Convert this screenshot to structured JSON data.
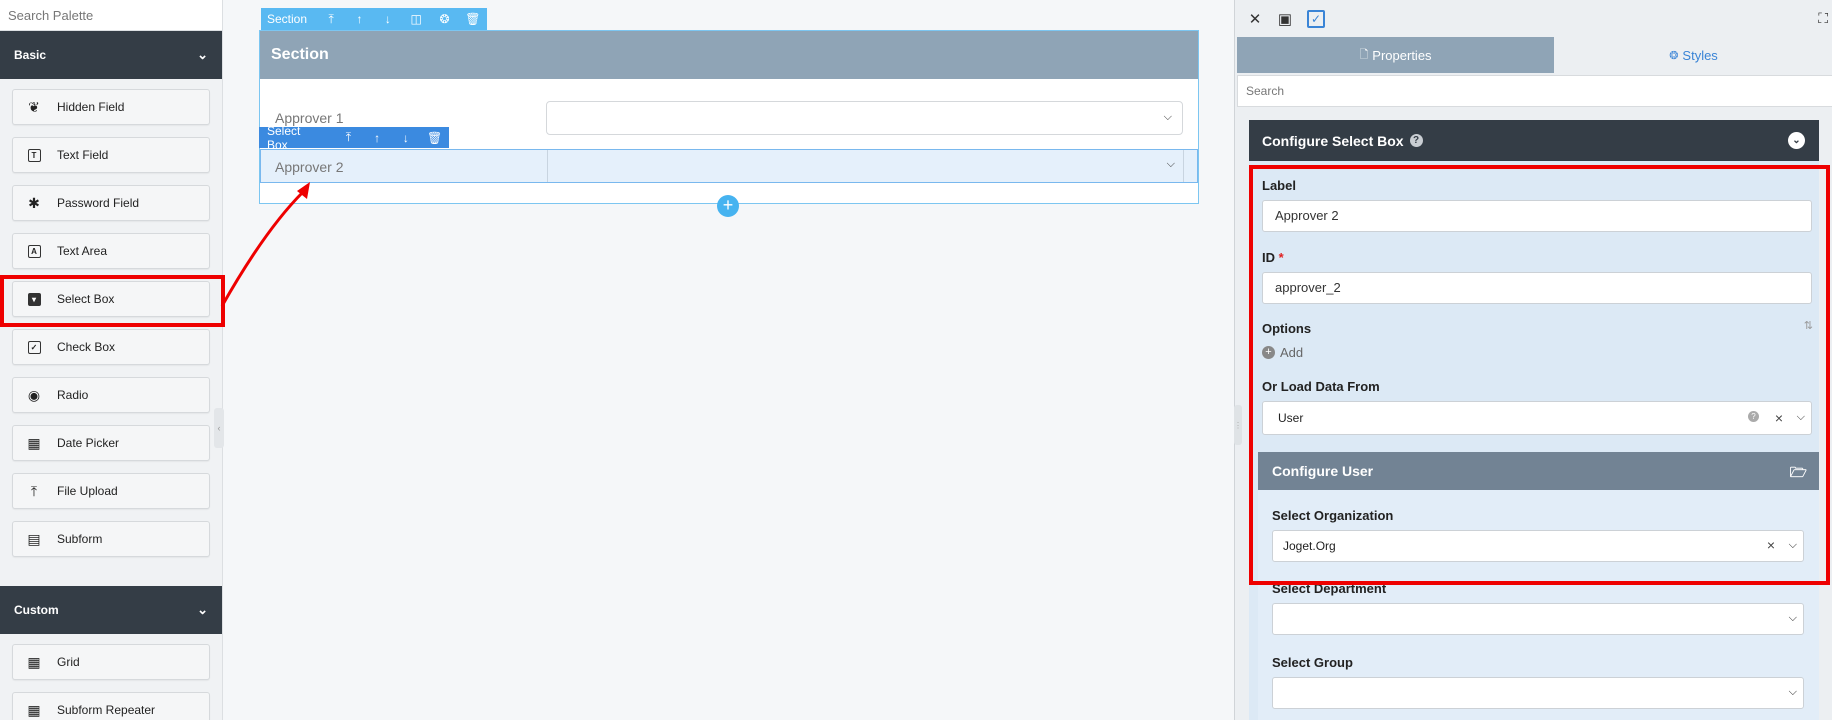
{
  "palette": {
    "search_placeholder": "Search Palette",
    "basic_label": "Basic",
    "custom_label": "Custom",
    "basic_items": [
      {
        "label": "Hidden Field",
        "icon": "eye-slash-icon"
      },
      {
        "label": "Text Field",
        "icon": "text-field-icon"
      },
      {
        "label": "Password Field",
        "icon": "asterisk-icon"
      },
      {
        "label": "Text Area",
        "icon": "text-area-icon"
      },
      {
        "label": "Select Box",
        "icon": "select-box-icon"
      },
      {
        "label": "Check Box",
        "icon": "checkbox-icon"
      },
      {
        "label": "Radio",
        "icon": "radio-icon"
      },
      {
        "label": "Date Picker",
        "icon": "calendar-icon"
      },
      {
        "label": "File Upload",
        "icon": "upload-icon"
      },
      {
        "label": "Subform",
        "icon": "subform-icon"
      }
    ],
    "custom_items": [
      {
        "label": "Grid",
        "icon": "grid-icon"
      },
      {
        "label": "Subform Repeater",
        "icon": "subform-repeater-icon"
      }
    ]
  },
  "canvas": {
    "section_toolbar_label": "Section",
    "section_title": "Section",
    "selectbox_toolbar_label": "Select Box",
    "field1_label": "Approver 1",
    "field2_label": "Approver 2"
  },
  "properties": {
    "tab_properties": "Properties",
    "tab_styles": "Styles",
    "search_placeholder": "Search",
    "config_title": "Configure Select Box",
    "label_label": "Label",
    "label_value": "Approver 2",
    "id_label": "ID",
    "id_value": "approver_2",
    "options_label": "Options",
    "options_add": "Add",
    "loadfrom_label": "Or Load Data From",
    "loadfrom_value": "User",
    "config_user_title": "Configure User",
    "org_label": "Select Organization",
    "org_value": "Joget.Org",
    "dept_label": "Select Department",
    "group_label": "Select Group"
  },
  "colors": {
    "highlight": "#ee0000",
    "accent_blue": "#3a84d6",
    "dark_header": "#343d46",
    "section_header": "#8fa4b6"
  }
}
